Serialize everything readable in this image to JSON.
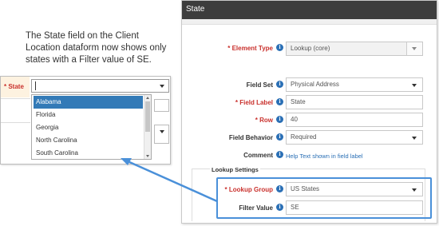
{
  "caption": {
    "line1": "The State field on the Client",
    "line2": "Location dataform now shows only",
    "line3": "states with a Filter value of SE."
  },
  "left_form": {
    "state_label": "* State",
    "input_value": "",
    "options": [
      "Alabama",
      "Florida",
      "Georgia",
      "North Carolina",
      "South Carolina"
    ],
    "selected_index": 0
  },
  "dialog": {
    "title": "State",
    "fields": {
      "element_type": {
        "label": "Element Type",
        "value": "Lookup (core)"
      },
      "field_set": {
        "label": "Field Set",
        "value": "Physical Address"
      },
      "field_label": {
        "label": "Field Label",
        "value": "State"
      },
      "row": {
        "label": "Row",
        "value": "40"
      },
      "field_behavior": {
        "label": "Field Behavior",
        "value": "Required"
      },
      "comment": {
        "label": "Comment",
        "value": "Help Text shown in field label"
      }
    },
    "lookup_settings": {
      "heading": "Lookup Settings",
      "lookup_group": {
        "label": "Lookup Group",
        "value": "US States"
      },
      "filter_value": {
        "label": "Filter Value",
        "value": "SE"
      }
    },
    "required_mark": "*",
    "info_glyph": "i"
  },
  "colors": {
    "title_bar": "#3d3d3d",
    "required_red": "#c9302c",
    "info_blue": "#2a6fb5",
    "selection_blue": "#337ab7",
    "highlight_blue": "#4a90d9"
  }
}
